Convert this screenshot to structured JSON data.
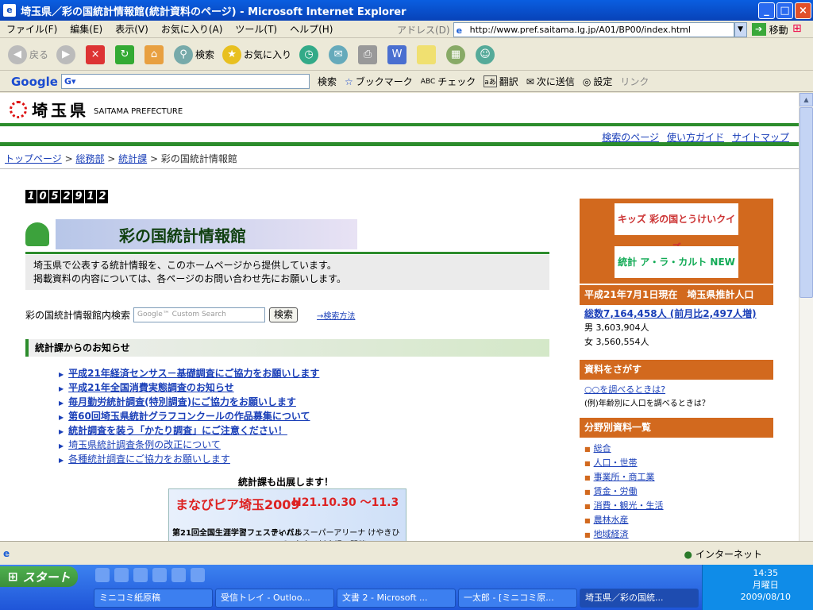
{
  "window": {
    "title": "埼玉県／彩の国統計情報館(統計資料のページ) - Microsoft Internet Explorer",
    "buttons": {
      "minimize": "_",
      "maximize": "□",
      "close": "×"
    }
  },
  "menubar": {
    "items": [
      "ファイル(F)",
      "編集(E)",
      "表示(V)",
      "お気に入り(A)",
      "ツール(T)",
      "ヘルプ(H)"
    ],
    "address_label": "アドレス(D)",
    "address": "http://www.pref.saitama.lg.jp/A01/BP00/index.html",
    "go_label": "移動"
  },
  "toolbar": {
    "back": "戻る",
    "search": "検索",
    "favorites": "お気に入り"
  },
  "google_toolbar": {
    "logo": "Google",
    "search_btn": "検索",
    "bookmarks": "ブックマーク",
    "check": "チェック",
    "translate": "翻訳",
    "send": "次に送信",
    "settings": "設定",
    "link": "リンク"
  },
  "page": {
    "logo_name": "埼玉県",
    "logo_en": "SAITAMA PREFECTURE",
    "top_links": [
      "検索のページ",
      "使い方ガイド",
      "サイトマップ"
    ],
    "breadcrumb": {
      "links": [
        "トップページ",
        "総務部",
        "統計課"
      ],
      "current": "彩の国統計情報館"
    },
    "counter": "1052912",
    "banner_title": "彩の国統計情報館",
    "intro": [
      "埼玉県で公表する統計情報を、このホームページから提供しています。",
      "掲載資料の内容については、各ページのお問い合わせ先にお願いします。"
    ],
    "search_label": "彩の国統計情報館内検索",
    "search_placeholder": "Google™ Custom Search",
    "search_button": "検索",
    "search_help": "→検索方法",
    "notice_heading": "統計課からのお知らせ",
    "news": [
      {
        "text": "平成21年経済センサス－基礎調査にご協力をお願いします",
        "bold": true
      },
      {
        "text": "平成21年全国消費実態調査のお知らせ",
        "bold": true
      },
      {
        "text": "毎月勤労統計調査(特別調査)にご協力をお願いします",
        "bold": true
      },
      {
        "text": "第60回埼玉県統計グラフコンクールの作品募集について",
        "bold": true
      },
      {
        "text": "統計調査を装う「かたり調査」にご注意ください！",
        "bold": true
      },
      {
        "text": "埼玉県統計調査条例の改正について",
        "bold": false
      },
      {
        "text": "各種統計調査にご協力をお願いします",
        "bold": false
      }
    ],
    "exhibit_heading": "統計課も出展します！",
    "exhibit": {
      "title": "まなびピア埼玉2009",
      "dates": "H21.10.30 ～11.3",
      "subtitle": "第21回全国生涯学習フェスティバル",
      "venue": "さいたまスーパーアリーナ けやきひろば、各市町村会場で開催"
    }
  },
  "sidebar": {
    "quiz": "キッズ 彩の国とうけいクイズ",
    "carte": "統計 ア・ラ・カルト NEW",
    "population_head": "平成21年7月1日現在　埼玉県推計人口",
    "population_total": "総数7,164,458人 (前月比2,497人増)",
    "male": "男 3,603,904人",
    "female": "女 3,560,554人",
    "search_head": "資料をさがす",
    "search_link": "○○を調べるときは?",
    "search_example": "(例)年齢別に人口を調べるときは？",
    "category_head": "分野別資料一覧",
    "categories": [
      "総合",
      "人口・世帯",
      "事業所・商工業",
      "賃金・労働",
      "消費・観光・生活",
      "農林水産",
      "地域経済"
    ]
  },
  "statusbar": {
    "zone": "インターネット"
  },
  "taskbar": {
    "start": "スタート",
    "tasks": [
      "ミニコミ紙原稿",
      "受信トレイ - Outloo...",
      "文書 2 - Microsoft ...",
      "一太郎 - [ミニコミ原...",
      "埼玉県／彩の国統..."
    ],
    "time": "14:35",
    "weekday": "月曜日",
    "date": "2009/08/10"
  }
}
